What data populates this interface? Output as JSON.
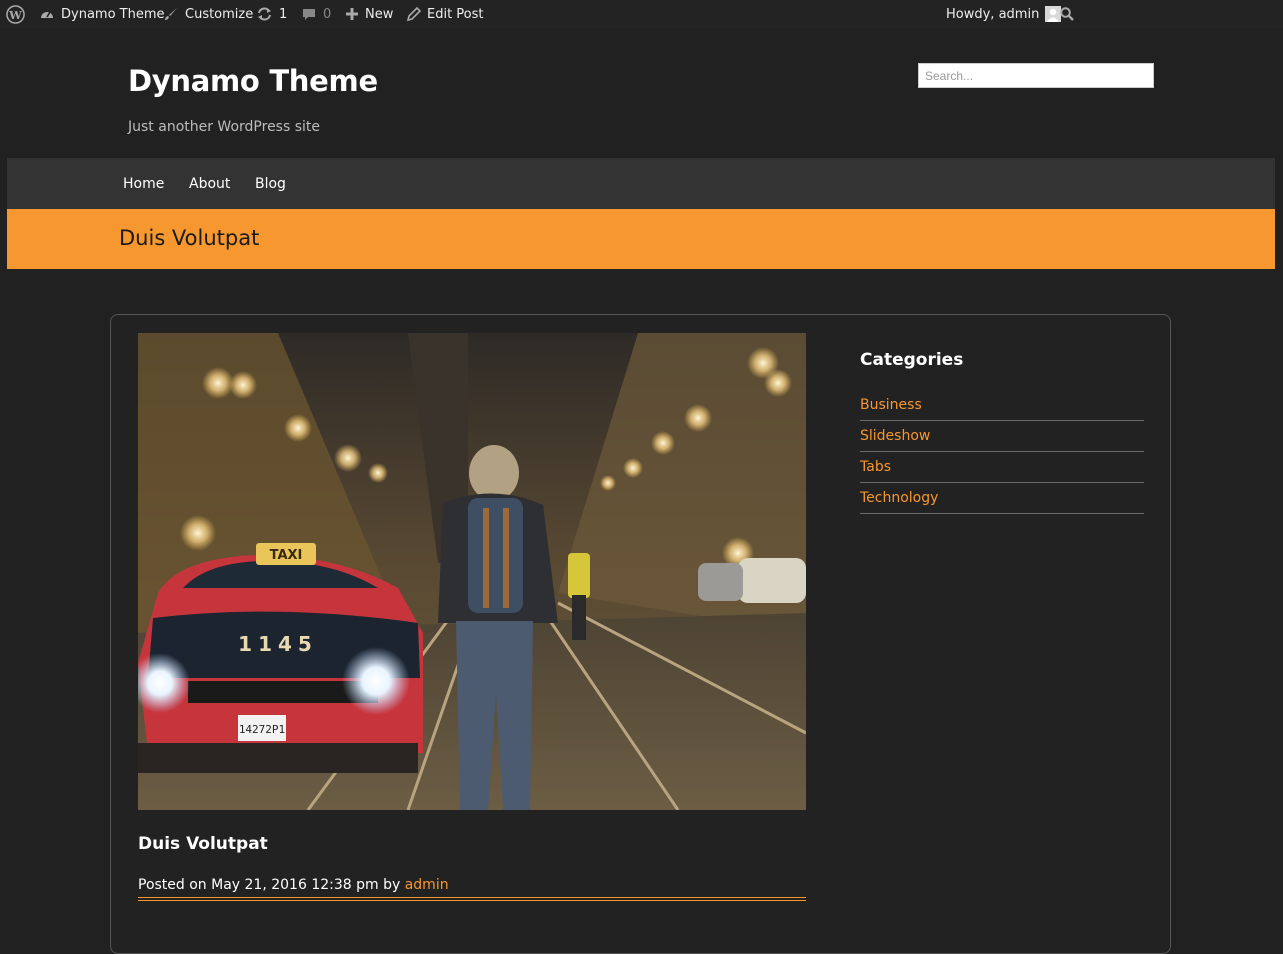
{
  "admin_bar": {
    "wp_logo_icon": "wordpress-logo-icon",
    "site_name": "Dynamo Theme",
    "customize": "Customize",
    "updates_count": "1",
    "comments_count": "0",
    "new": "New",
    "edit_post": "Edit Post",
    "howdy": "Howdy, admin",
    "search_icon": "search-icon"
  },
  "header": {
    "site_title": "Dynamo Theme",
    "tagline": "Just another WordPress site",
    "search_placeholder": "Search..."
  },
  "nav": {
    "items": [
      {
        "label": "Home"
      },
      {
        "label": "About"
      },
      {
        "label": "Blog"
      }
    ]
  },
  "page_title": "Duis Volutpat",
  "post": {
    "image_alt": "Night street scene with taxi and hooded pedestrian",
    "title": "Duis Volutpat",
    "posted_on": "Posted on May 21, 2016 12:38 pm by",
    "author": "admin"
  },
  "sidebar": {
    "widget_title": "Categories",
    "categories": [
      {
        "label": "Business"
      },
      {
        "label": "Slideshow"
      },
      {
        "label": "Tabs"
      },
      {
        "label": "Technology"
      }
    ]
  },
  "colors": {
    "accent": "#f7972f",
    "background": "#212121",
    "nav": "#333333"
  }
}
